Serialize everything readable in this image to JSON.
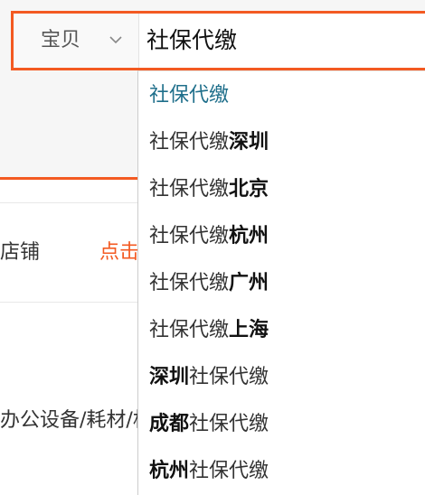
{
  "search": {
    "scope_label": "宝贝",
    "query": "社保代缴"
  },
  "background": {
    "shop_label": "店铺",
    "click_label": "点击",
    "category_label": "办公设备/耗材/相"
  },
  "suggestions": [
    {
      "base": "社保代缴",
      "bold": "",
      "bold_first": false
    },
    {
      "base": "社保代缴",
      "bold": "深圳",
      "bold_first": false
    },
    {
      "base": "社保代缴",
      "bold": "北京",
      "bold_first": false
    },
    {
      "base": "社保代缴",
      "bold": "杭州",
      "bold_first": false
    },
    {
      "base": "社保代缴",
      "bold": "广州",
      "bold_first": false
    },
    {
      "base": "社保代缴",
      "bold": "上海",
      "bold_first": false
    },
    {
      "base": "社保代缴",
      "bold": "深圳",
      "bold_first": true
    },
    {
      "base": "社保代缴",
      "bold": "成都",
      "bold_first": true
    },
    {
      "base": "社保代缴",
      "bold": "杭州",
      "bold_first": true
    }
  ],
  "colors": {
    "accent": "#f35a22",
    "active_suggestion": "#1f6f8b"
  },
  "icons": {
    "scope_chevron": "chevron-down-icon"
  }
}
